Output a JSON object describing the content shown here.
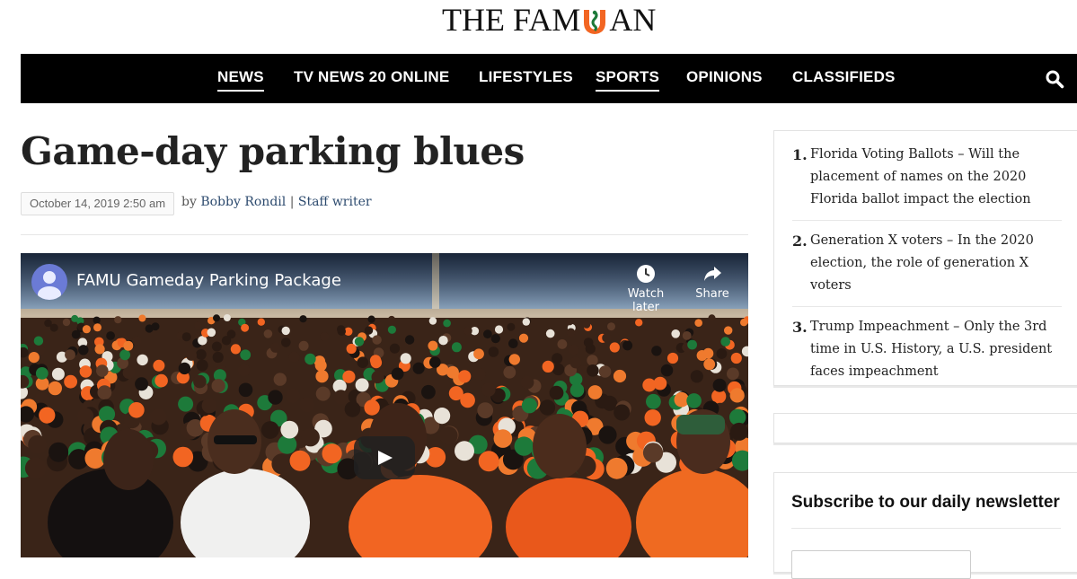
{
  "site": {
    "logo_left": "THE FAM",
    "logo_right": "AN"
  },
  "nav": {
    "items": [
      {
        "label": "NEWS",
        "active": true
      },
      {
        "label": "TV NEWS 20 ONLINE",
        "active": false
      },
      {
        "label": "LIFESTYLES",
        "active": false
      },
      {
        "label": "SPORTS",
        "active": true
      },
      {
        "label": "OPINIONS",
        "active": false
      },
      {
        "label": "CLASSIFIEDS",
        "active": false
      }
    ],
    "search_icon": "search-icon"
  },
  "article": {
    "title": "Game-day parking blues",
    "date": "October 14, 2019 2:50 am",
    "by": "by",
    "author": "Bobby Rondil",
    "divider": "|",
    "role": "Staff writer"
  },
  "video": {
    "title": "FAMU Gameday Parking Package",
    "watch_later": "Watch later",
    "share": "Share",
    "colors": {
      "orange": "#f26522",
      "green": "#1d7a3a"
    }
  },
  "sidebar": {
    "trending": [
      {
        "num": "1.",
        "text": "Florida Voting Ballots – Will the placement of names on the 2020 Florida ballot impact the election"
      },
      {
        "num": "2.",
        "text": "Generation X voters – In the 2020 election, the role of generation X voters"
      },
      {
        "num": "3.",
        "text": "Trump Impeachment – Only the 3rd time in U.S. History, a U.S. president faces impeachment"
      }
    ],
    "newsletter_title": "Subscribe to our daily newsletter"
  }
}
